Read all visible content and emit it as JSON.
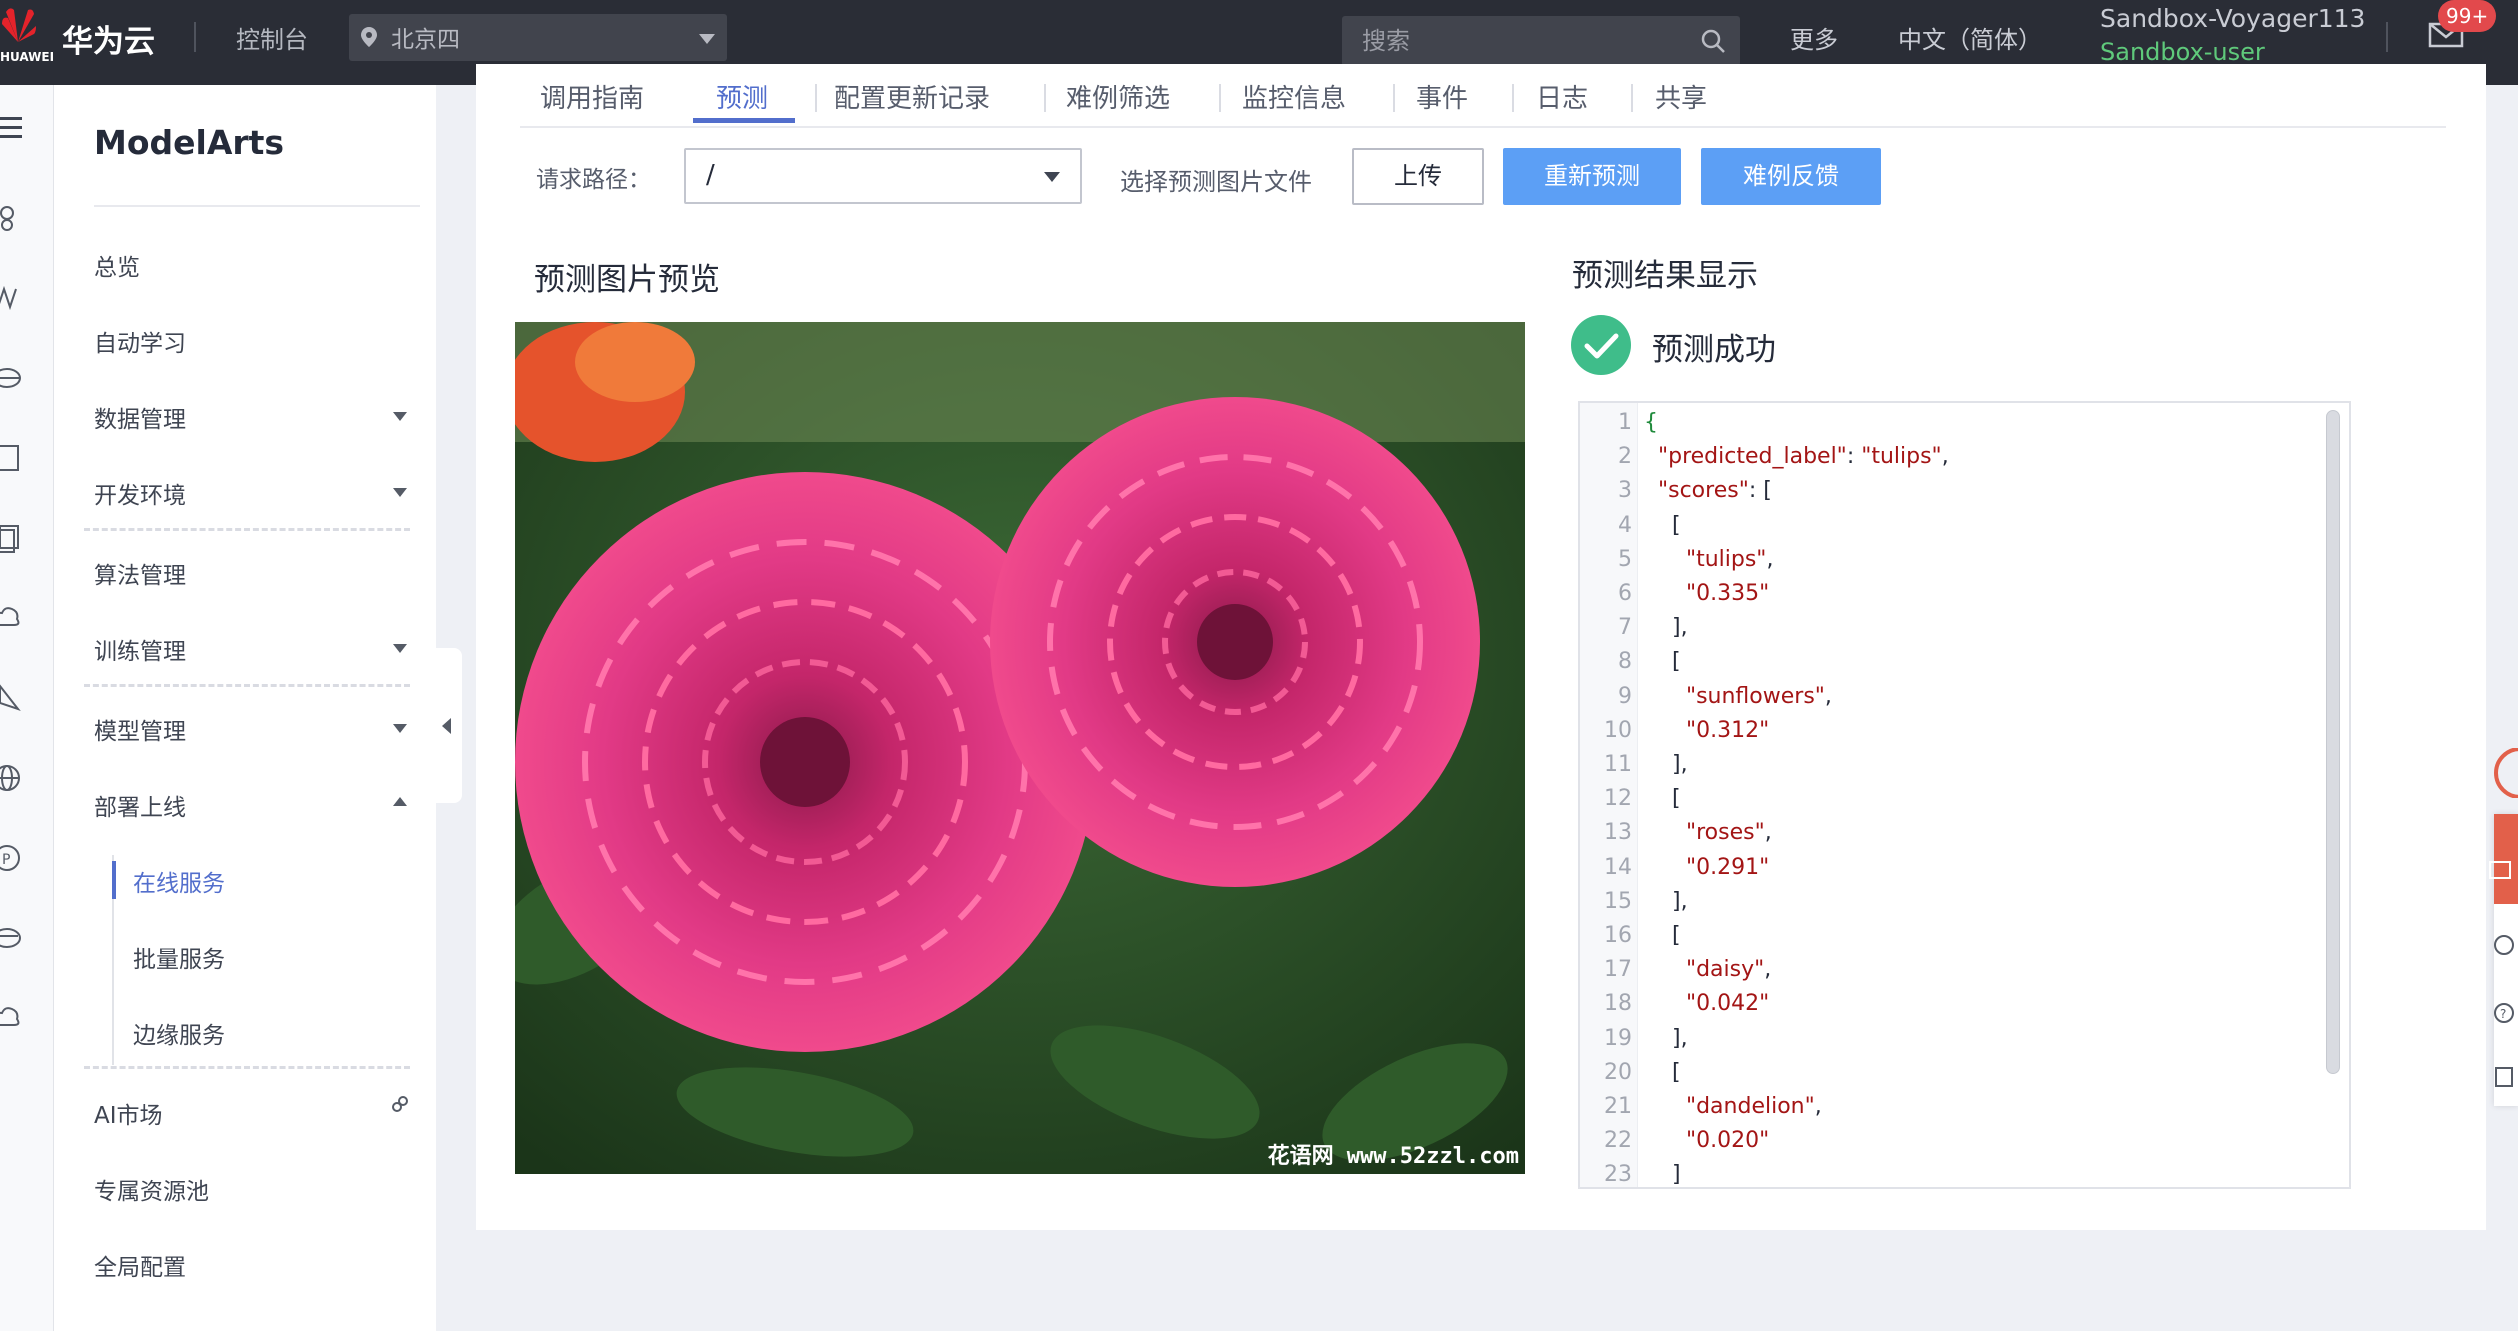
{
  "topbar": {
    "logo_text": "HUAWEI",
    "brand": "华为云",
    "console": "控制台",
    "region": "北京四",
    "search_placeholder": "搜索",
    "more": "更多",
    "language": "中文（简体）",
    "account_name": "Sandbox-Voyager113",
    "account_user": "Sandbox-user",
    "notification_count": "99+"
  },
  "sidebar": {
    "title": "ModelArts",
    "items": [
      {
        "label": "总览"
      },
      {
        "label": "自动学习"
      },
      {
        "label": "数据管理"
      },
      {
        "label": "开发环境"
      },
      {
        "label": "算法管理"
      },
      {
        "label": "训练管理"
      },
      {
        "label": "模型管理"
      },
      {
        "label": "部署上线"
      },
      {
        "label": "在线服务"
      },
      {
        "label": "批量服务"
      },
      {
        "label": "边缘服务"
      },
      {
        "label": "AI市场"
      },
      {
        "label": "专属资源池"
      },
      {
        "label": "全局配置"
      }
    ]
  },
  "tabs": [
    "调用指南",
    "预测",
    "配置更新记录",
    "难例筛选",
    "监控信息",
    "事件",
    "日志",
    "共享"
  ],
  "toolbar": {
    "request_path_label": "请求路径：",
    "request_path_value": "/",
    "pick_image_label": "选择预测图片文件",
    "upload": "上传",
    "repredict": "重新预测",
    "hard_example_feedback": "难例反馈"
  },
  "preview": {
    "title": "预测图片预览",
    "watermark": "花语网 www.52zzl.com"
  },
  "result": {
    "title": "预测结果显示",
    "status": "预测成功",
    "lines": [
      {
        "n": "1",
        "t": "{"
      },
      {
        "n": "2",
        "t": "  \"predicted_label\": \"tulips\","
      },
      {
        "n": "3",
        "t": "  \"scores\": ["
      },
      {
        "n": "4",
        "t": "    ["
      },
      {
        "n": "5",
        "t": "      \"tulips\","
      },
      {
        "n": "6",
        "t": "      \"0.335\""
      },
      {
        "n": "7",
        "t": "    ],"
      },
      {
        "n": "8",
        "t": "    ["
      },
      {
        "n": "9",
        "t": "      \"sunflowers\","
      },
      {
        "n": "10",
        "t": "      \"0.312\""
      },
      {
        "n": "11",
        "t": "    ],"
      },
      {
        "n": "12",
        "t": "    ["
      },
      {
        "n": "13",
        "t": "      \"roses\","
      },
      {
        "n": "14",
        "t": "      \"0.291\""
      },
      {
        "n": "15",
        "t": "    ],"
      },
      {
        "n": "16",
        "t": "    ["
      },
      {
        "n": "17",
        "t": "      \"daisy\","
      },
      {
        "n": "18",
        "t": "      \"0.042\""
      },
      {
        "n": "19",
        "t": "    ],"
      },
      {
        "n": "20",
        "t": "    ["
      },
      {
        "n": "21",
        "t": "      \"dandelion\","
      },
      {
        "n": "22",
        "t": "      \"0.020\""
      },
      {
        "n": "23",
        "t": "    ]"
      }
    ]
  },
  "colors": {
    "topbar_bg": "#2a2d36",
    "accent_blue": "#526ecc",
    "button_blue": "#5c9ff5",
    "success_green": "#3fbd8a",
    "user_green": "#5fc97b",
    "badge_red": "#e2494c"
  },
  "icons": {
    "logo": "huawei-logo",
    "region": "location-pin-icon",
    "search": "search-icon",
    "mail": "mail-icon",
    "success": "check-circle-icon",
    "menu": "hamburger-icon"
  }
}
